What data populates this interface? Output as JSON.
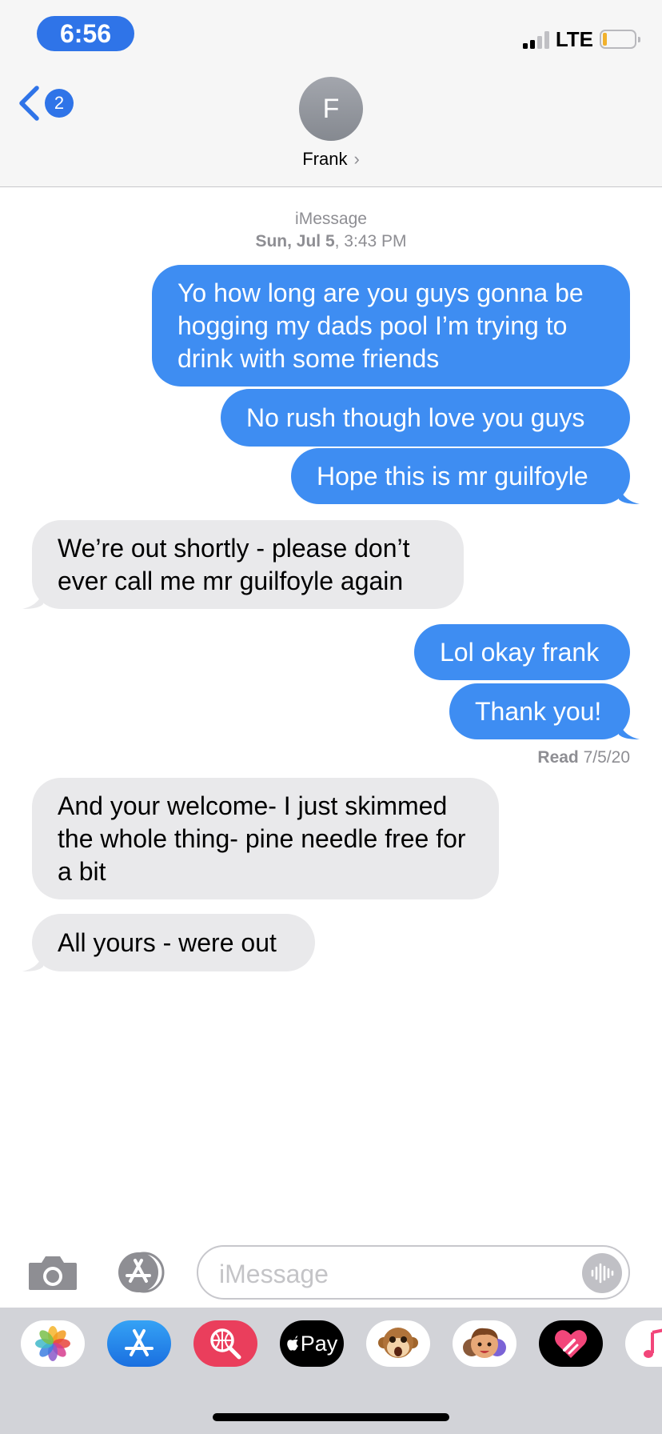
{
  "status": {
    "time": "6:56",
    "network": "LTE",
    "battery_color": "#f1b12c"
  },
  "nav": {
    "back_badge": "2",
    "contact_initial": "F",
    "contact_name": "Frank",
    "contact_chevron": "›"
  },
  "conversation": {
    "service_label": "iMessage",
    "date_bold": "Sun, Jul 5",
    "date_time": ", 3:43 PM",
    "messages": [
      {
        "from": "me",
        "text": "Yo how long are you guys gonna be hogging my dads pool I’m trying to drink with some friends"
      },
      {
        "from": "me",
        "text": "No rush though love you guys"
      },
      {
        "from": "me",
        "text": "Hope this is mr guilfoyle"
      },
      {
        "from": "them",
        "text": "We’re out shortly - please don’t ever call me mr guilfoyle again"
      },
      {
        "from": "me",
        "text": "Lol okay frank"
      },
      {
        "from": "me",
        "text": "Thank you!"
      },
      {
        "from": "them",
        "text": "And your welcome- I just skimmed the whole thing- pine needle free for a bit"
      },
      {
        "from": "them",
        "text": "All yours - were out"
      }
    ],
    "read_label": "Read",
    "read_date": "7/5/20"
  },
  "composer": {
    "placeholder": "iMessage"
  },
  "app_drawer": {
    "apps": [
      {
        "name": "photos-app",
        "icon": "photos-icon"
      },
      {
        "name": "app-store-app",
        "icon": "app-store-icon"
      },
      {
        "name": "images-search-app",
        "icon": "globe-search-icon"
      },
      {
        "name": "apple-pay-app",
        "icon": "apple-pay-icon",
        "label": "Pay"
      },
      {
        "name": "animoji-app",
        "icon": "monkey-icon"
      },
      {
        "name": "memoji-app",
        "icon": "memoji-icon"
      },
      {
        "name": "digital-touch-app",
        "icon": "heart-icon"
      },
      {
        "name": "music-app",
        "icon": "music-note-icon"
      }
    ]
  },
  "colors": {
    "accent": "#2f74e8",
    "outgoing_bubble": "#3e8df2",
    "incoming_bubble": "#e9e9eb"
  }
}
